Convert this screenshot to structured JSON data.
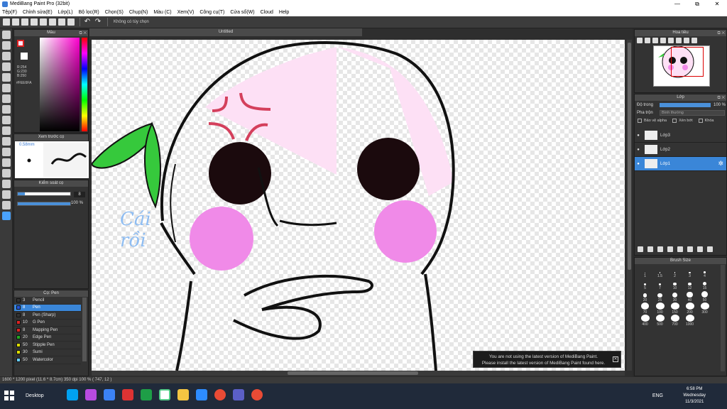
{
  "window": {
    "title": "MediBang Paint Pro (32bit)",
    "controls": [
      "—",
      "⧉",
      "✕"
    ]
  },
  "menu": [
    "Tệp(F)",
    "Chỉnh sửa(E)",
    "Lớp(L)",
    "Bộ lọc(R)",
    "Chọn(S)",
    "Chụp(N)",
    "Màu (C)",
    "Xem(V)",
    "Công cụ(T)",
    "Cửa sổ(W)",
    "Cloud",
    "Help"
  ],
  "toolbar": {
    "option_text": "Không có tùy chọn"
  },
  "color_panel": {
    "title": "Màu",
    "fg": "#FEE6FA",
    "rgb": [
      "R:254",
      "G:230",
      "B:250"
    ],
    "hex": "#FEE6FA"
  },
  "preview_panel": {
    "title": "Xem trước cọ",
    "size": "0.58mm"
  },
  "brush_control": {
    "title": "Kiểm soát cọ",
    "size_value": "8",
    "opacity": "100 %"
  },
  "pen_panel": {
    "title": "Cọ: Pen",
    "items": [
      {
        "num": "3",
        "name": "Pencil",
        "color": "#333333"
      },
      {
        "num": "8",
        "name": "Pen",
        "color": "#2255dd"
      },
      {
        "num": "8",
        "name": "Pen (Sharp)",
        "color": "#333333"
      },
      {
        "num": "10",
        "name": "G Pen",
        "color": "#dd2222"
      },
      {
        "num": "8",
        "name": "Mapping Pen",
        "color": "#dd2222"
      },
      {
        "num": "20",
        "name": "Edge Pen",
        "color": "#22aa22"
      },
      {
        "num": "50",
        "name": "Stipple Pen",
        "color": "#dddd00"
      },
      {
        "num": "30",
        "name": "Sumi",
        "color": "#dddd00"
      },
      {
        "num": "50",
        "name": "Watercolor",
        "color": "#66ccff"
      }
    ]
  },
  "document": {
    "tab": "Untitled",
    "text_art": [
      "Cái",
      "rồi"
    ]
  },
  "notice": {
    "line1": "You are not using the latest version of MediBang Paint.",
    "line2": "Please install the latest version of MediBang Paint found here."
  },
  "navigator": {
    "title": "Hoa tiêu"
  },
  "layer_panel": {
    "title": "Lớp",
    "opacity_label": "Độ trong",
    "opacity_value": "100 %",
    "blend_label": "Pha trộn",
    "blend_value": "Bình thường",
    "checks": [
      "Bảo vệ alpha",
      "Xén bớt",
      "Khóa"
    ],
    "layers": [
      "Lớp3",
      "Lớp2",
      "Lớp1"
    ]
  },
  "brush_size": {
    "title": "Brush Size",
    "sizes": [
      "1",
      "1.5",
      "2",
      "3",
      "4",
      "5",
      "7",
      "10",
      "12",
      "15",
      "20",
      "25",
      "30",
      "40",
      "50",
      "70",
      "100",
      "150",
      "200",
      "300",
      "400",
      "500",
      "700",
      "1000"
    ]
  },
  "status": {
    "text": "1600 * 1200 pixel   (11.6 * 8.7cm)   350 dpi   100 %   ( 747, 12 )"
  },
  "taskbar": {
    "desktop": "Desktop",
    "lang": "ENG",
    "time": "6:58 PM",
    "day": "Wednesday",
    "date": "11/3/2021"
  }
}
